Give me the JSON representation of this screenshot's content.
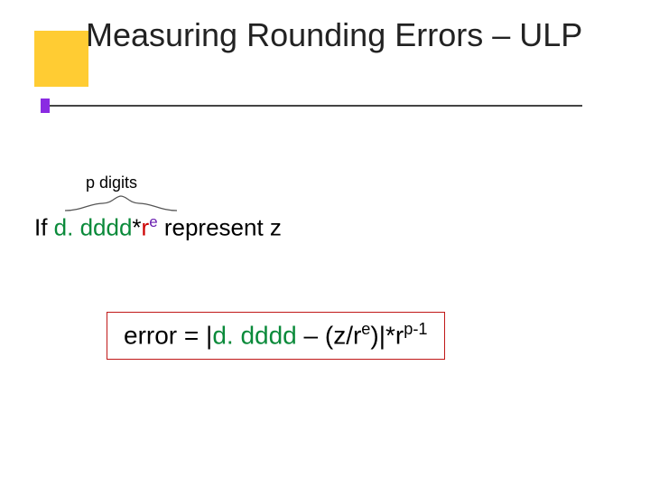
{
  "slide": {
    "title": "Measuring Rounding Errors – ULP",
    "p_digits_label": "p digits",
    "line_if": "If ",
    "mantissa": "d. dddd",
    "asterisk": "*",
    "radix": "r",
    "exp_e": "e",
    "represent": "  represent z",
    "formula": {
      "error_eq": "error = |",
      "mantissa2": "d. dddd",
      "mid": " – (z/r",
      "close_exp": ")|*r",
      "p_minus_1": "p-1"
    }
  }
}
